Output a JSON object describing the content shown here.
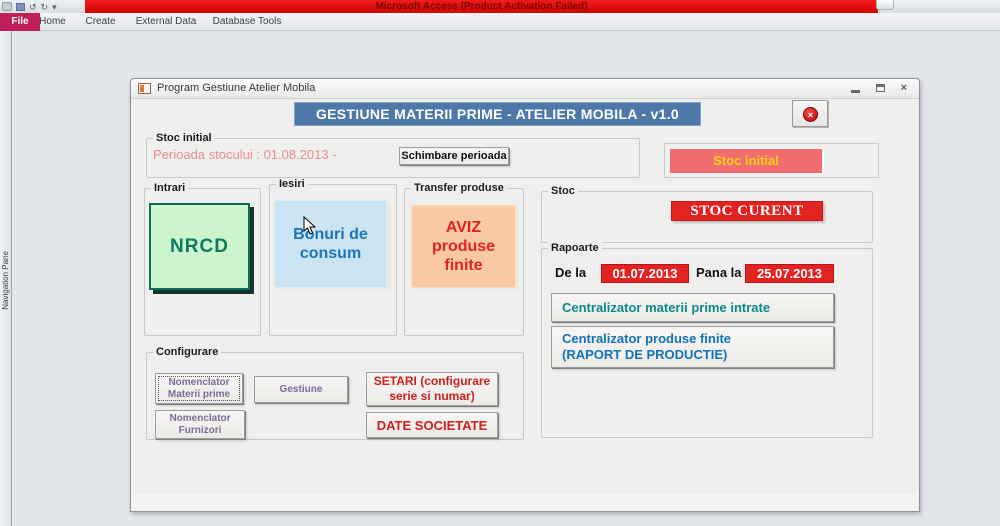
{
  "titlebar": {
    "title": "Microsoft Access (Product Activation Failed)"
  },
  "ribbon": {
    "tabs": [
      "File",
      "Home",
      "Create",
      "External Data",
      "Database Tools"
    ]
  },
  "nav_pane": {
    "label": "Navigation Pane"
  },
  "form": {
    "title": "Program Gestiune Atelier Mobila",
    "heading": "GESTIUNE MATERII PRIME - ATELIER MOBILA - v1.0",
    "stoc_initial": {
      "group_label": "Stoc initial",
      "perioada_text": "Perioada stocului : 01.08.2013 -",
      "schimbare_button": "Schimbare perioada",
      "stoc_initial_button": "Stoc initial"
    },
    "intrari": {
      "group_label": "Intrari",
      "nrcd_button": "NRCD"
    },
    "iesiri": {
      "group_label": "Iesiri",
      "bonuri_button": "Bonuri de consum"
    },
    "transfer": {
      "group_label": "Transfer produse",
      "aviz_button": "AVIZ produse finite"
    },
    "stoc": {
      "group_label": "Stoc",
      "stoc_curent_button": "STOC CURENT"
    },
    "rapoarte": {
      "group_label": "Rapoarte",
      "de_la_label": "De la",
      "de_la_value": "01.07.2013",
      "pana_la_label": "Pana la",
      "pana_la_value": "25.07.2013",
      "centralizator_materii_button": "Centralizator materii prime intrate",
      "centralizator_produse_line1": "Centralizator  produse finite",
      "centralizator_produse_line2": "(RAPORT DE PRODUCTIE)"
    },
    "configurare": {
      "group_label": "Configurare",
      "nomenclator_materii_button": "Nomenclator Materii prime",
      "gestiune_button": "Gestiune",
      "nomenclator_furnizori_button": "Nomenclator Furnizori",
      "setari_button": "SETARI (configurare serie si numar)",
      "date_societate_button": "DATE SOCIETATE"
    }
  },
  "colors": {
    "titlebar_red": "#e30613",
    "file_tab": "#bf1e56",
    "heading_blue": "#4d78a8",
    "nrcd_green": "#cdf5cd",
    "bonuri_blue": "#cae5f1",
    "aviz_orange": "#f8c9a2",
    "stoc_red": "#e32222",
    "stoc_initial_pink": "#f26d6d"
  }
}
